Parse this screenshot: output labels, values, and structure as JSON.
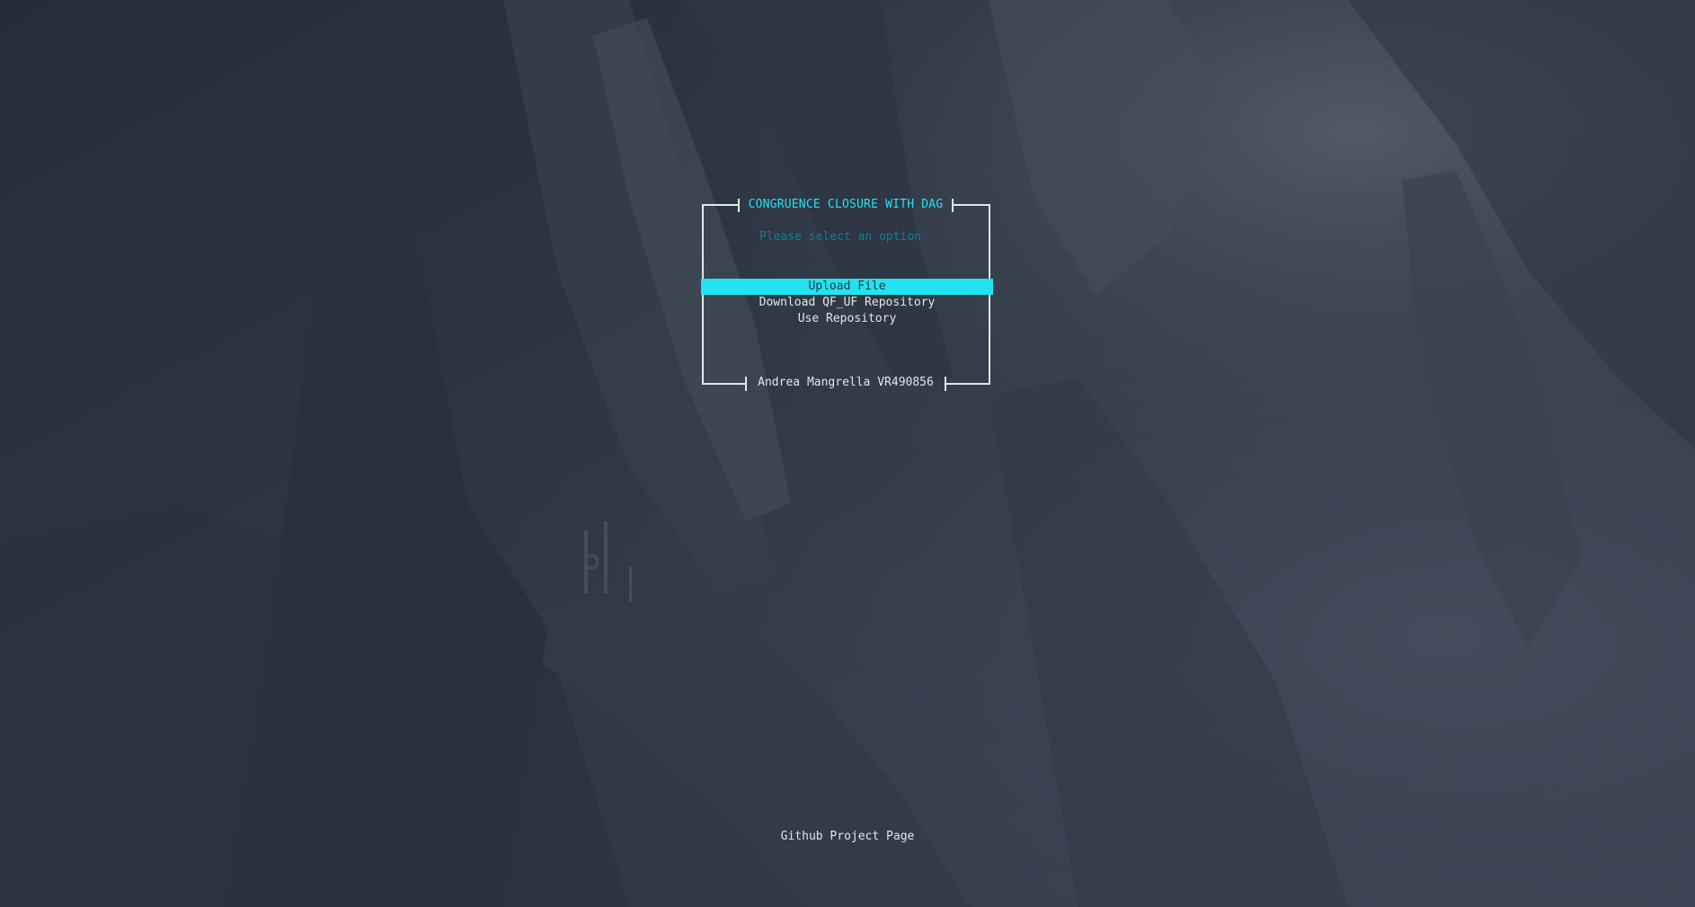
{
  "app": {
    "title": "CONGRUENCE CLOSURE WITH DAG",
    "prompt": "Please select an option",
    "author": "Andrea Mangrella VR490856"
  },
  "menu": {
    "items": [
      {
        "label": "Upload File",
        "selected": true
      },
      {
        "label": "Download QF_UF Repository",
        "selected": false
      },
      {
        "label": "Use Repository",
        "selected": false
      }
    ]
  },
  "footer": {
    "link_label": "Github Project Page"
  },
  "colors": {
    "accent": "#22e3ee",
    "prompt": "#0d7f93",
    "text": "#e3e6ea",
    "background": "#2c3442"
  }
}
